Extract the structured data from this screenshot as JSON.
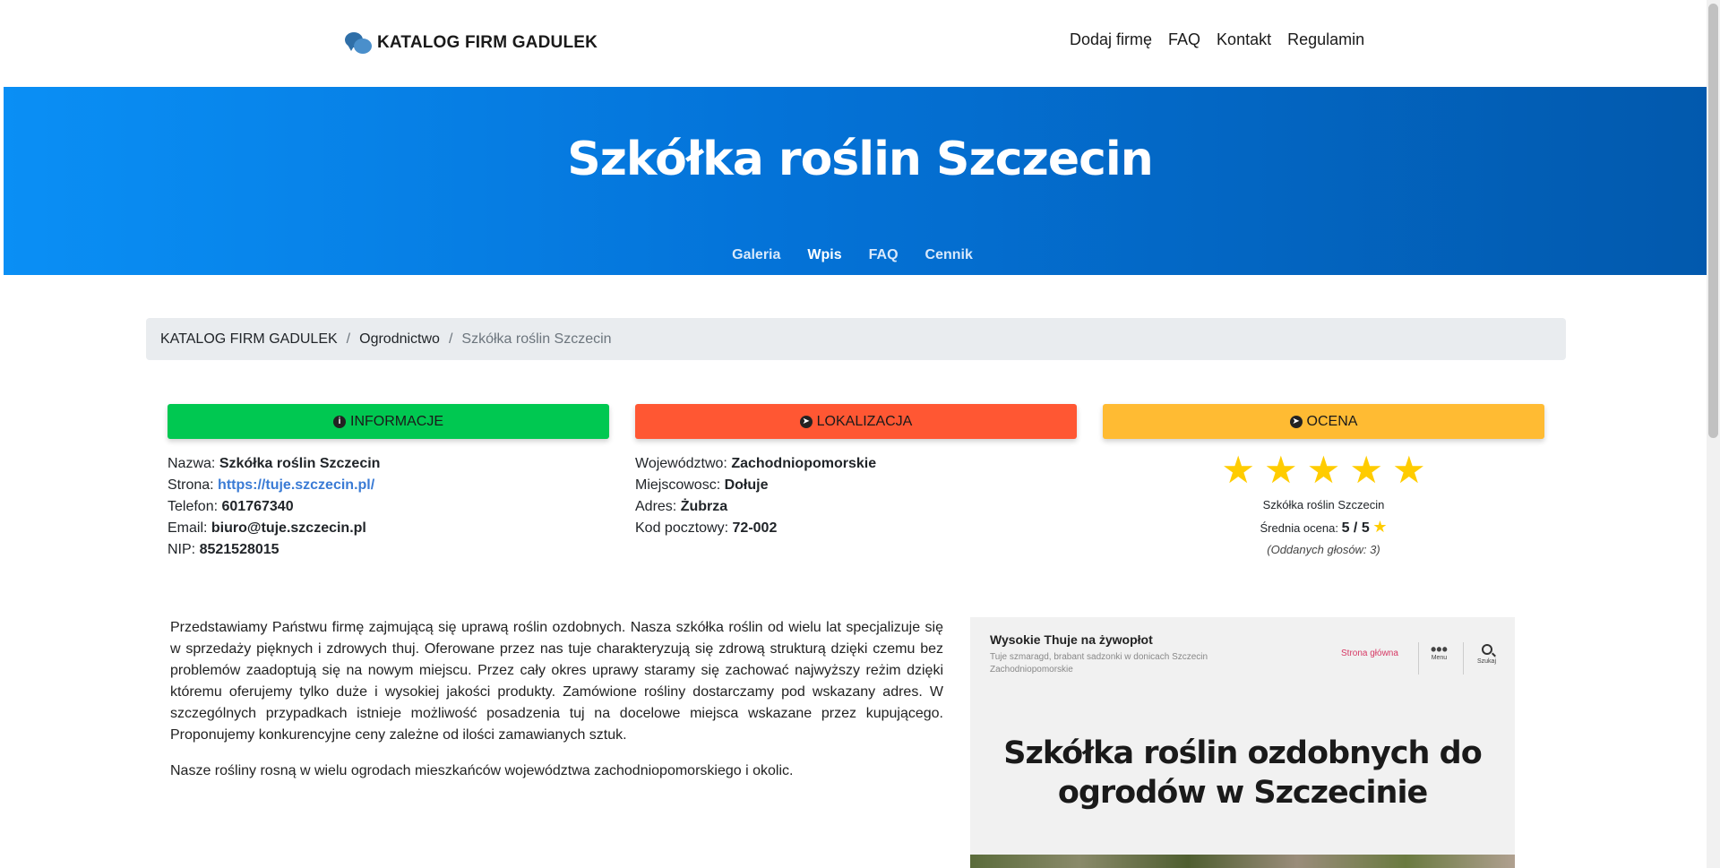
{
  "brand": {
    "name": "KATALOG FIRM GADULEK"
  },
  "nav": {
    "items": [
      {
        "label": "Dodaj firmę"
      },
      {
        "label": "FAQ"
      },
      {
        "label": "Kontakt"
      },
      {
        "label": "Regulamin"
      }
    ]
  },
  "hero": {
    "title": "Szkółka roślin Szczecin",
    "tabs": [
      {
        "label": "Galeria",
        "active": false
      },
      {
        "label": "Wpis",
        "active": true
      },
      {
        "label": "FAQ",
        "active": false
      },
      {
        "label": "Cennik",
        "active": false
      }
    ]
  },
  "breadcrumb": {
    "items": [
      {
        "label": "KATALOG FIRM GADULEK"
      },
      {
        "label": "Ogrodnictwo"
      }
    ],
    "current": "Szkółka roślin Szczecin",
    "separator": "/"
  },
  "info": {
    "title": "INFORMACJE",
    "icon": "info-circle-icon",
    "color": "#00c851",
    "name_label": "Nazwa:",
    "name_value": "Szkółka roślin Szczecin",
    "site_label": "Strona:",
    "site_value": "https://tuje.szczecin.pl/",
    "phone_label": "Telefon:",
    "phone_value": "601767340",
    "email_label": "Email:",
    "email_value": "biuro@tuje.szczecin.pl",
    "nip_label": "NIP:",
    "nip_value": "8521528015"
  },
  "location": {
    "title": "LOKALIZACJA",
    "icon": "compass-icon",
    "color": "#ff5733",
    "voivodeship_label": "Województwo:",
    "voivodeship_value": "Zachodniopomorskie",
    "city_label": "Miejscowosc:",
    "city_value": "Dołuje",
    "address_label": "Adres:",
    "address_value": "Żubrza",
    "postal_label": "Kod pocztowy:",
    "postal_value": "72-002"
  },
  "rating": {
    "title": "OCENA",
    "icon": "compass-icon",
    "color": "#ffbb33",
    "stars": 5,
    "company": "Szkółka roślin Szczecin",
    "avg_label": "Średnia ocena:",
    "avg_value": "5 / 5",
    "votes": "(Oddanych głosów: 3)"
  },
  "description": {
    "p1": "Przedstawiamy Państwu firmę zajmującą się uprawą roślin ozdobnych. Nasza szkółka roślin od wielu lat specjalizuje się w sprzedaży pięknych i zdrowych thuj. Oferowane przez nas tuje charakteryzują się zdrową strukturą dzięki czemu bez problemów zaadoptują się na nowym miejscu. Przez cały okres uprawy staramy się zachować najwyższy reżim dzięki któremu oferujemy tylko duże i wysokiej jakości produkty. Zamówione rośliny dostarczamy pod wskazany adres. W szczególnych przypadkach istnieje możliwość posadzenia tuj na docelowe miejsca wskazane przez kupującego. Proponujemy konkurencyjne ceny zależne od ilości zamawianych sztuk.",
    "p2": "Nasze rośliny rosną w wielu ogrodach mieszkańców województwa zachodniopomorskiego i okolic."
  },
  "preview": {
    "site_title": "Wysokie Thuje na żywopłot",
    "tagline": "Tuje szmaragd, brabant sadzonki w donicach Szczecin Zachodniopomorskie",
    "home_link": "Strona główna",
    "menu_label": "Menu",
    "search_label": "Szukaj",
    "headline": "Szkółka roślin ozdobnych do ogrodów w Szczecinie"
  }
}
